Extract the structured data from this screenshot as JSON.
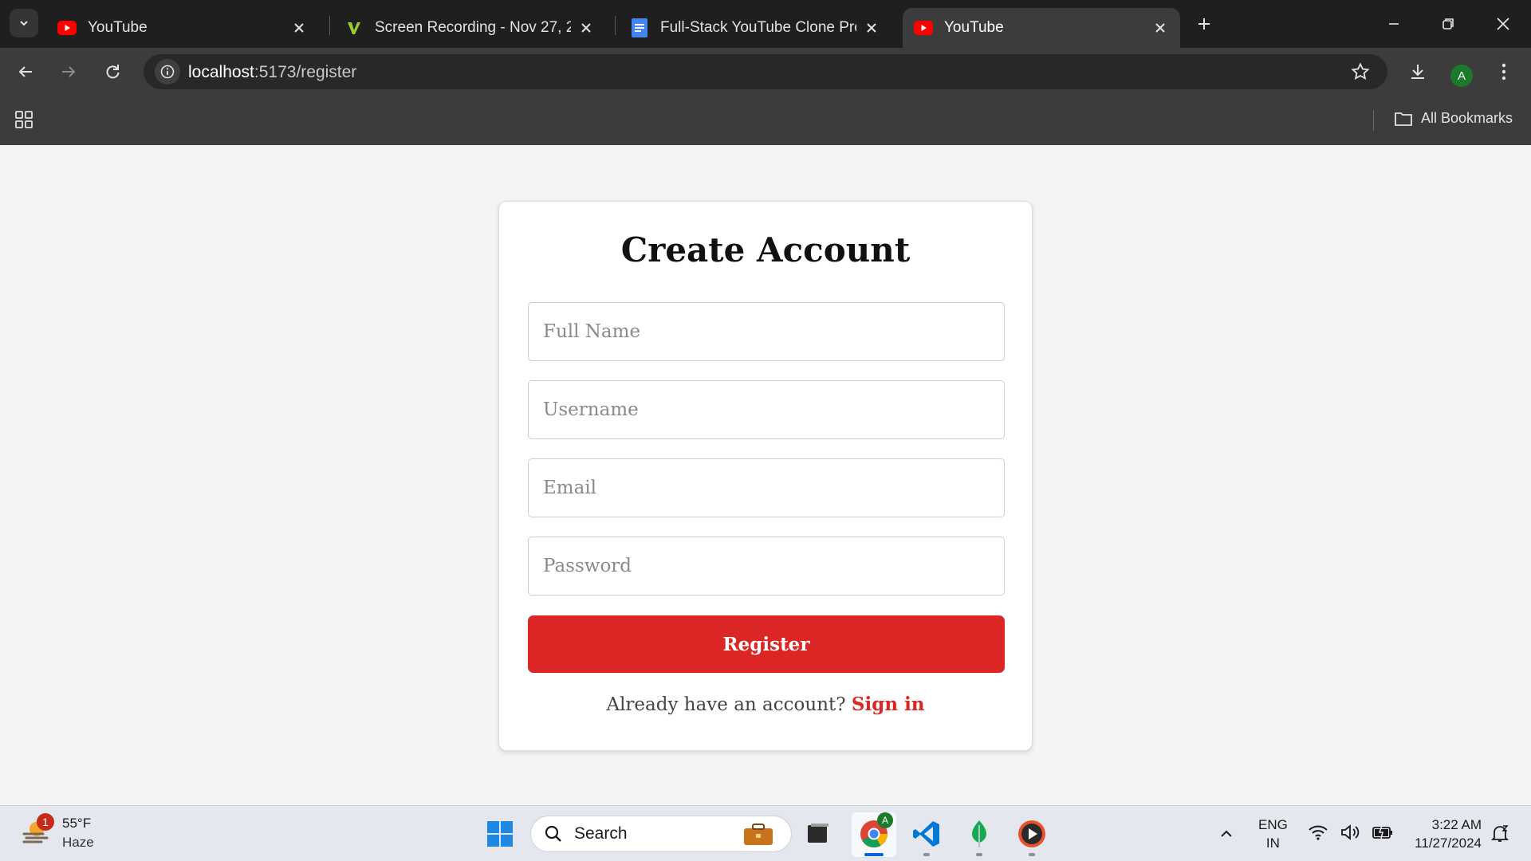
{
  "browser": {
    "tabs": [
      {
        "title": "YouTube",
        "favicon": "youtube-icon"
      },
      {
        "title": "Screen Recording - Nov 27, 202",
        "favicon": "vimeo-icon"
      },
      {
        "title": "Full-Stack YouTube Clone Proje",
        "favicon": "google-docs-icon"
      },
      {
        "title": "YouTube",
        "favicon": "youtube-icon",
        "active": true
      }
    ],
    "url_host": "localhost",
    "url_rest": ":5173/register",
    "profile_initial": "A",
    "bookmarks_label": "All Bookmarks"
  },
  "page": {
    "title": "Create Account",
    "fields": {
      "full_name_placeholder": "Full Name",
      "username_placeholder": "Username",
      "email_placeholder": "Email",
      "password_placeholder": "Password"
    },
    "register_label": "Register",
    "signin_prompt": "Already have an account?",
    "signin_link": "Sign in",
    "accent_color": "#dc2626"
  },
  "taskbar": {
    "weather_temp": "55°F",
    "weather_condition": "Haze",
    "weather_badge": "1",
    "search_label": "Search",
    "chrome_badge": "A",
    "lang_line1": "ENG",
    "lang_line2": "IN",
    "time": "3:22 AM",
    "date": "11/27/2024"
  }
}
